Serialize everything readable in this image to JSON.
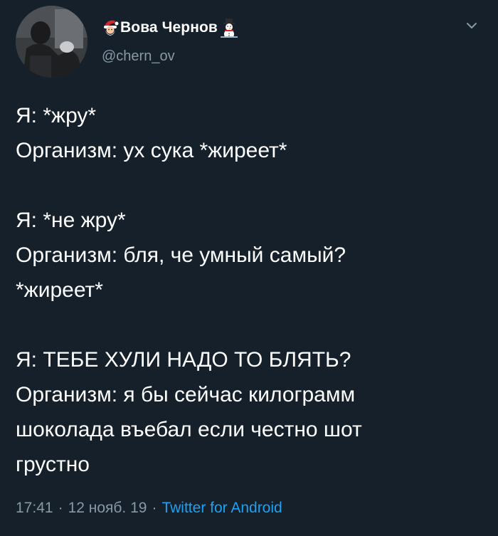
{
  "user": {
    "display_name": "Вова Чернов",
    "handle": "@chern_ov",
    "name_prefix_emoji": "santa-emoji",
    "name_suffix_emoji": "snowman-emoji"
  },
  "tweet": {
    "lines": [
      "Я: *жру*",
      "Организм: ух сука *жиреет*",
      "",
      "Я: *не жру*",
      "Организм: бля, че умный самый?",
      "*жиреет*",
      "",
      "Я: ТЕБЕ ХУЛИ НАДО ТО БЛЯТЬ?",
      "Организм: я бы сейчас килограмм",
      "шоколада въебал если честно шот",
      "грустно"
    ]
  },
  "meta": {
    "time": "17:41",
    "date": "12 нояб. 19",
    "separator": "·",
    "source": "Twitter for Android"
  },
  "icons": {
    "menu": "chevron-down-icon"
  },
  "colors": {
    "background": "#15202b",
    "text": "#ffffff",
    "secondary": "#8899a6",
    "link": "#1da1f2"
  }
}
